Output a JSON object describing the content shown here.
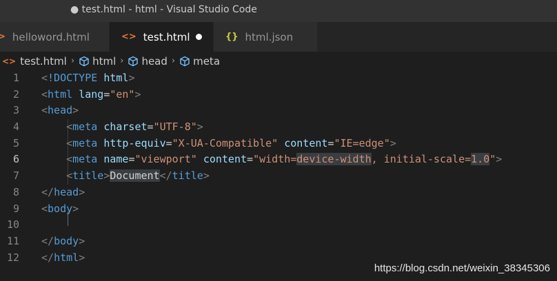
{
  "window": {
    "title": "● test.html - html - Visual Studio Code"
  },
  "tabs": [
    {
      "icon": "html-icon",
      "label": "helloword.html",
      "active": false
    },
    {
      "icon": "html-icon",
      "label": "test.html",
      "active": true,
      "dirty": true
    },
    {
      "icon": "json-icon",
      "label": "html.json",
      "active": false
    }
  ],
  "icons": {
    "html_glyph": "<>",
    "json_glyph": "{}",
    "chevron": "›"
  },
  "breadcrumb": [
    "test.html",
    "html",
    "head",
    "meta"
  ],
  "editor": {
    "current_line": 6,
    "line_numbers": [
      "1",
      "2",
      "3",
      "4",
      "5",
      "6",
      "7",
      "8",
      "9",
      "10",
      "11",
      "12"
    ],
    "lines": [
      [
        [
          "t-punc",
          "<"
        ],
        [
          "t-tag",
          "!DOCTYPE"
        ],
        [
          "t-text",
          " "
        ],
        [
          "t-attr",
          "html"
        ],
        [
          "t-punc",
          ">"
        ]
      ],
      [
        [
          "t-punc",
          "<"
        ],
        [
          "t-tag",
          "html"
        ],
        [
          "t-text",
          " "
        ],
        [
          "t-attr",
          "lang"
        ],
        [
          "t-text",
          "="
        ],
        [
          "t-str",
          "\"en\""
        ],
        [
          "t-punc",
          ">"
        ]
      ],
      [
        [
          "t-punc",
          "<"
        ],
        [
          "t-tag",
          "head"
        ],
        [
          "t-punc",
          ">"
        ]
      ],
      [
        [
          "t-text",
          "    "
        ],
        [
          "t-punc",
          "<"
        ],
        [
          "t-tag",
          "meta"
        ],
        [
          "t-text",
          " "
        ],
        [
          "t-attr",
          "charset"
        ],
        [
          "t-text",
          "="
        ],
        [
          "t-str",
          "\"UTF-8\""
        ],
        [
          "t-punc",
          ">"
        ]
      ],
      [
        [
          "t-text",
          "    "
        ],
        [
          "t-punc",
          "<"
        ],
        [
          "t-tag",
          "meta"
        ],
        [
          "t-text",
          " "
        ],
        [
          "t-attr",
          "http-equiv"
        ],
        [
          "t-text",
          "="
        ],
        [
          "t-str",
          "\"X-UA-Compatible\""
        ],
        [
          "t-text",
          " "
        ],
        [
          "t-attr",
          "content"
        ],
        [
          "t-text",
          "="
        ],
        [
          "t-str",
          "\"IE=edge\""
        ],
        [
          "t-punc",
          ">"
        ]
      ],
      [
        [
          "t-text",
          "    "
        ],
        [
          "t-punc",
          "<"
        ],
        [
          "t-tag",
          "meta"
        ],
        [
          "t-text",
          " "
        ],
        [
          "t-attr",
          "name"
        ],
        [
          "t-text",
          "="
        ],
        [
          "t-str",
          "\"viewport\""
        ],
        [
          "t-text",
          " "
        ],
        [
          "t-attr",
          "content"
        ],
        [
          "t-text",
          "="
        ],
        [
          "t-str",
          "\"width="
        ],
        [
          "t-str hl",
          "device-width"
        ],
        [
          "t-str",
          ", initial-scale="
        ],
        [
          "t-str hl",
          "1.0"
        ],
        [
          "t-str",
          "\""
        ],
        [
          "t-punc",
          ">"
        ]
      ],
      [
        [
          "t-text",
          "    "
        ],
        [
          "t-punc",
          "<"
        ],
        [
          "t-tag",
          "title"
        ],
        [
          "t-punc",
          ">"
        ],
        [
          "t-text hl",
          "Document"
        ],
        [
          "t-punc",
          "</"
        ],
        [
          "t-tag",
          "title"
        ],
        [
          "t-punc",
          ">"
        ]
      ],
      [
        [
          "t-punc",
          "</"
        ],
        [
          "t-tag",
          "head"
        ],
        [
          "t-punc",
          ">"
        ]
      ],
      [
        [
          "t-punc",
          "<"
        ],
        [
          "t-tag",
          "body"
        ],
        [
          "t-punc",
          ">"
        ]
      ],
      [
        [
          "t-text",
          ""
        ]
      ],
      [
        [
          "t-punc",
          "</"
        ],
        [
          "t-tag",
          "body"
        ],
        [
          "t-punc",
          ">"
        ]
      ],
      [
        [
          "t-punc",
          "</"
        ],
        [
          "t-tag",
          "html"
        ],
        [
          "t-punc",
          ">"
        ]
      ]
    ]
  },
  "watermark": "https://blog.csdn.net/weixin_38345306"
}
